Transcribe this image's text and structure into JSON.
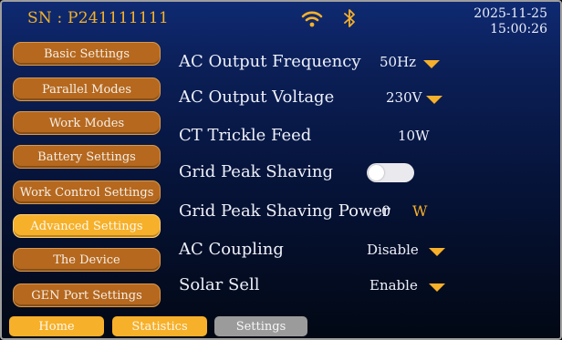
{
  "header": {
    "serial": "SN : P241111111",
    "date": "2025-11-25",
    "time": "15:00:26",
    "icons": [
      "wifi-icon",
      "bluetooth-icon"
    ]
  },
  "menu": {
    "items": [
      {
        "label": "Basic Settings",
        "active": false
      },
      {
        "label": "Parallel Modes",
        "active": false
      },
      {
        "label": "Work Modes",
        "active": false
      },
      {
        "label": "Battery Settings",
        "active": false
      },
      {
        "label": "Work Control Settings",
        "active": false
      },
      {
        "label": "Advanced Settings",
        "active": true
      },
      {
        "label": "The Device",
        "active": false
      },
      {
        "label": "GEN Port Settings",
        "active": false
      }
    ]
  },
  "settings": {
    "ac_output_frequency": {
      "label": "AC Output Frequency",
      "value": "50Hz"
    },
    "ac_output_voltage": {
      "label": "AC Output Voltage",
      "value": "230V"
    },
    "ct_trickle_feed": {
      "label": "CT Trickle Feed",
      "value": "10W"
    },
    "grid_peak_shaving": {
      "label": "Grid Peak Shaving",
      "enabled": false
    },
    "grid_peak_shaving_power": {
      "label": "Grid Peak Shaving Power",
      "value": "0",
      "unit": "W"
    },
    "ac_coupling": {
      "label": "AC Coupling",
      "value": "Disable"
    },
    "solar_sell": {
      "label": "Solar Sell",
      "value": "Enable"
    }
  },
  "tabs": [
    {
      "label": "Home"
    },
    {
      "label": "Statistics"
    },
    {
      "label": "Settings"
    }
  ],
  "colors": {
    "accent": "#f6b02a",
    "menu_button": "#b5681e",
    "tab_inactive": "#9b9b9b"
  }
}
